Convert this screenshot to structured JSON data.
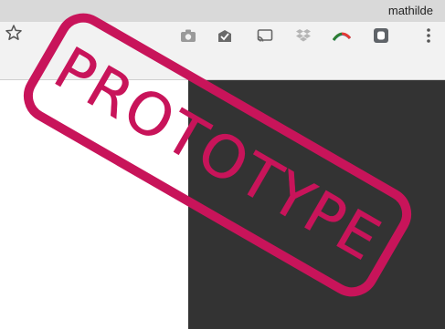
{
  "window": {
    "profile_name": "mathilde"
  },
  "toolbar": {
    "icons": [
      "bookmark-star-icon",
      "camera-icon",
      "envelope-check-icon",
      "cast-icon",
      "dropbox-icon",
      "arc-icon",
      "shield-square-icon",
      "kebab-menu-icon"
    ]
  },
  "overlay": {
    "stamp_text": "PROTOTYPE",
    "stamp_color": "#c8145a"
  },
  "colors": {
    "titlebar": "#d9d9d9",
    "toolbar": "#f2f2f2",
    "dark_panel": "#333333"
  }
}
